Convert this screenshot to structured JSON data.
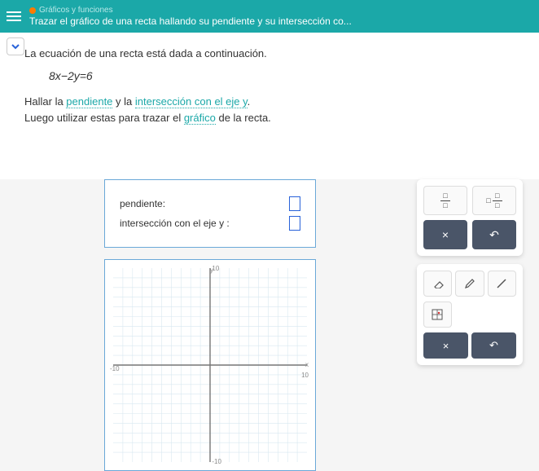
{
  "header": {
    "breadcrumb": "Gráficos y funciones",
    "title": "Trazar el gráfico de una recta hallando su pendiente y su intersección co..."
  },
  "problem": {
    "intro": "La ecuación de una recta está dada a continuación.",
    "equation": "8x−2y=6",
    "instr_pre1": "Hallar la ",
    "link_slope": "pendiente",
    "instr_mid1": " y la ",
    "link_intercept": "intersección con el eje y",
    "instr_post1": ".",
    "instr_line2_pre": "Luego utilizar estas para trazar el ",
    "link_graph": "gráfico",
    "instr_line2_post": " de la recta."
  },
  "answers": {
    "slope_label": "pendiente:",
    "intercept_label": "intersección con el eje y :"
  },
  "graph": {
    "range": [
      -10,
      10
    ],
    "ticks": [
      -10,
      -8,
      -6,
      -4,
      -2,
      2,
      4,
      6,
      8,
      10
    ]
  },
  "tools": {
    "times": "×",
    "undo": "↶"
  }
}
